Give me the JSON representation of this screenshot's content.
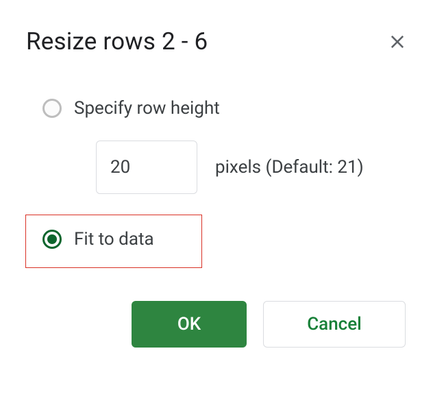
{
  "dialog": {
    "title": "Resize rows 2 - 6",
    "options": {
      "specify": {
        "label": "Specify row height",
        "selected": false
      },
      "fit": {
        "label": "Fit to data",
        "selected": true
      }
    },
    "input": {
      "value": "20",
      "unit_label": "pixels (Default: 21)"
    },
    "buttons": {
      "ok": "OK",
      "cancel": "Cancel"
    }
  }
}
